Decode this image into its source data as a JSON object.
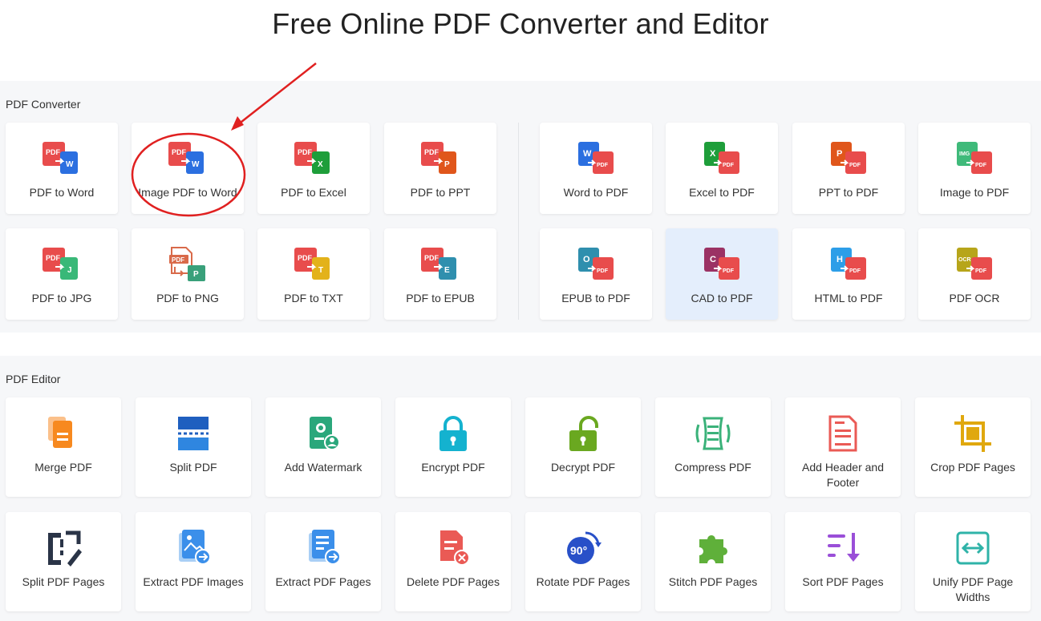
{
  "title": "Free Online PDF Converter and Editor",
  "converter": {
    "heading": "PDF Converter",
    "items": [
      {
        "label": "PDF to Word"
      },
      {
        "label": "Image PDF to Word"
      },
      {
        "label": "PDF to Excel"
      },
      {
        "label": "PDF to PPT"
      },
      {
        "label": "Word to PDF"
      },
      {
        "label": "Excel to PDF"
      },
      {
        "label": "PPT to PDF"
      },
      {
        "label": "Image to PDF"
      },
      {
        "label": "PDF to JPG"
      },
      {
        "label": "PDF to PNG"
      },
      {
        "label": "PDF to TXT"
      },
      {
        "label": "PDF to EPUB"
      },
      {
        "label": "EPUB to PDF"
      },
      {
        "label": "CAD to PDF"
      },
      {
        "label": "HTML to PDF"
      },
      {
        "label": "PDF OCR"
      }
    ],
    "badges": {
      "pdf": "PDF",
      "w": "W",
      "x": "X",
      "p": "P",
      "j": "J",
      "t": "T",
      "e": "E",
      "img": "IMG",
      "o": "O",
      "c": "C",
      "h": "H",
      "ocr": "OCR"
    }
  },
  "editor": {
    "heading": "PDF Editor",
    "items": [
      {
        "label": "Merge PDF"
      },
      {
        "label": "Split PDF"
      },
      {
        "label": "Add Watermark"
      },
      {
        "label": "Encrypt PDF"
      },
      {
        "label": "Decrypt PDF"
      },
      {
        "label": "Compress PDF"
      },
      {
        "label": "Add Header and Footer"
      },
      {
        "label": "Crop PDF Pages"
      },
      {
        "label": "Split PDF Pages"
      },
      {
        "label": "Extract PDF Images"
      },
      {
        "label": "Extract PDF Pages"
      },
      {
        "label": "Delete PDF Pages"
      },
      {
        "label": "Rotate PDF Pages"
      },
      {
        "label": "Stitch PDF Pages"
      },
      {
        "label": "Sort PDF Pages"
      },
      {
        "label": "Unify PDF Page Widths"
      }
    ],
    "rotate_badge": "90°"
  },
  "colors": {
    "pdf_red": "#e84c4c",
    "word_blue": "#2b6fe0",
    "excel_green": "#1e9e3a",
    "ppt_orange": "#e0561b",
    "jpg_teal": "#39b878",
    "txt_yellow": "#e3b21a",
    "epub_teal": "#2f8fae",
    "img_green": "#3fba7a",
    "cad_purple": "#9b3264",
    "html_blue": "#2d9ee8",
    "ocr_olive": "#b7a51a",
    "annotation_red": "#e02020",
    "highlight_bg": "#e4eefc"
  }
}
